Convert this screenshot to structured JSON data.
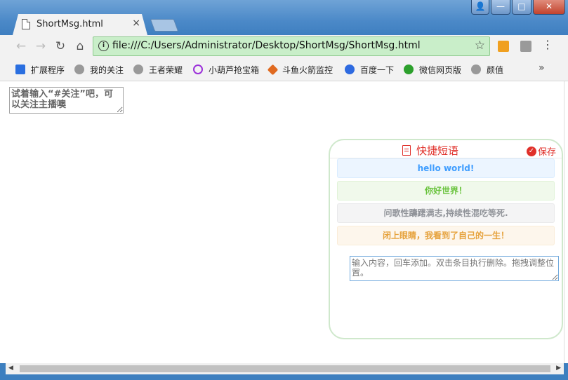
{
  "window": {
    "tab_title": "ShortMsg.html",
    "tab_close": "×",
    "controls": {
      "user": "👤",
      "minimize": "—",
      "maximize": "□",
      "close": "✕"
    }
  },
  "toolbar": {
    "back": "←",
    "forward": "→",
    "reload": "↻",
    "home": "⌂",
    "url": "file:///C:/Users/Administrator/Desktop/ShortMsg/ShortMsg.html",
    "star": "☆",
    "menu": "⋮"
  },
  "bookmarks": {
    "items": [
      {
        "label": "扩展程序",
        "icon": "puzzle-icon",
        "color": "#2a6fe0"
      },
      {
        "label": "我的关注",
        "icon": "douyu-fish-icon",
        "color": "#888888"
      },
      {
        "label": "王者荣耀",
        "icon": "douyu-fish-icon",
        "color": "#888888"
      },
      {
        "label": "小葫芦抢宝箱",
        "icon": "gourd-icon",
        "color": "#9b30d9"
      },
      {
        "label": "斗鱼火箭监控",
        "icon": "rocket-icon",
        "color": "#e06a20"
      },
      {
        "label": "百度一下",
        "icon": "baidu-paw-icon",
        "color": "#2e6ae0"
      },
      {
        "label": "微信网页版",
        "icon": "wechat-icon",
        "color": "#2ca02c"
      },
      {
        "label": "颜值",
        "icon": "douyu-fish-icon",
        "color": "#888888"
      }
    ],
    "more": "»"
  },
  "page": {
    "main_textarea_placeholder": "试着输入“#关注”吧，可以关注主播噢",
    "panel": {
      "title": "快捷短语",
      "save_label": "保存",
      "messages": [
        {
          "text": "hello world!",
          "style": "primary"
        },
        {
          "text": "你好世界！",
          "style": "success"
        },
        {
          "text": "问歌性躊躇满志,持续性混吃等死.",
          "style": "info"
        },
        {
          "text": "闭上眼睛，我看到了自己的一生！",
          "style": "warning"
        }
      ],
      "input_placeholder": "输入内容，回车添加。双击条目执行删除。拖拽调整位置。"
    }
  },
  "colors": {
    "accent_red": "#e0302a",
    "panel_border": "#cfe8cc",
    "omnibox_bg": "#c9eec9"
  }
}
